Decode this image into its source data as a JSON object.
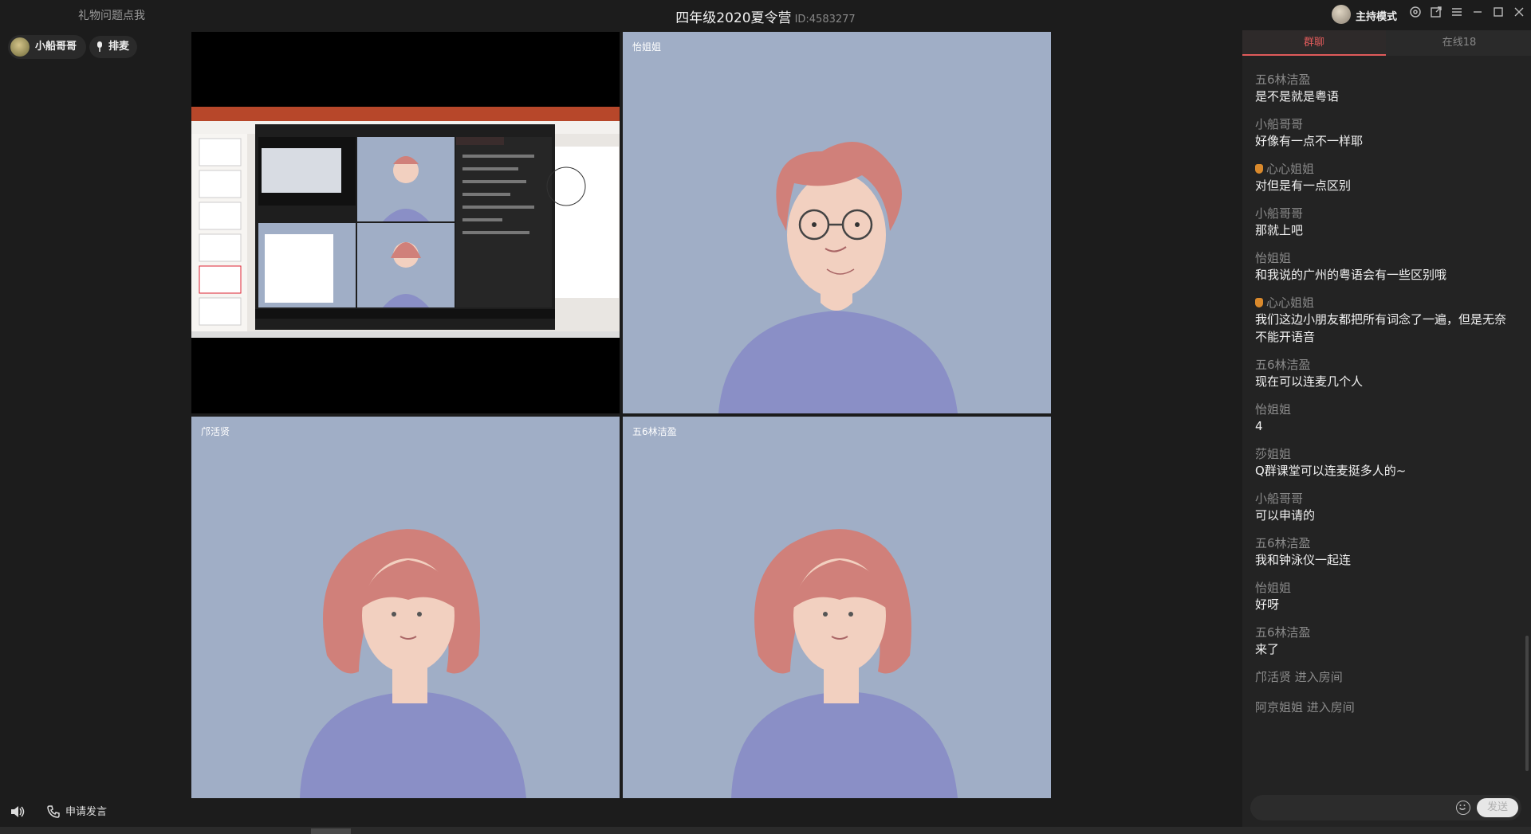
{
  "header": {
    "gift_link": "礼物问题点我",
    "room_title": "四年级2020夏令营",
    "room_id": "ID:4583277",
    "host_mode": "主持模式"
  },
  "left": {
    "user_name": "小船哥哥",
    "queue_label": "排麦"
  },
  "tiles": [
    {
      "label": ""
    },
    {
      "label": "怡姐姐"
    },
    {
      "label": "邝活贤"
    },
    {
      "label": "五6林洁盈"
    }
  ],
  "bottom": {
    "apply_label": "申请发言"
  },
  "chat": {
    "tab_group": "群聊",
    "tab_online": "在线18",
    "messages": [
      {
        "name": "五6林洁盈",
        "text": "是不是就是粤语"
      },
      {
        "name": "小船哥哥",
        "text": "好像有一点不一样耶"
      },
      {
        "name": "心心姐姐",
        "text": "对但是有一点区别"
      },
      {
        "name": "小船哥哥",
        "text": "那就上吧"
      },
      {
        "name": "怡姐姐",
        "text": "和我说的广州的粤语会有一些区别哦"
      },
      {
        "name": "心心姐姐",
        "text": "我们这边小朋友都把所有词念了一遍，但是无奈不能开语音"
      },
      {
        "name": "五6林洁盈",
        "text": "现在可以连麦几个人"
      },
      {
        "name": "怡姐姐",
        "text": "4"
      },
      {
        "name": "莎姐姐",
        "text": "Q群课堂可以连麦挺多人的~"
      },
      {
        "name": "小船哥哥",
        "text": "可以申请的"
      },
      {
        "name": "五6林洁盈",
        "text": "我和钟泳仪一起连"
      },
      {
        "name": "怡姐姐",
        "text": "好呀"
      },
      {
        "name": "五6林洁盈",
        "text": "来了"
      }
    ],
    "system": [
      "邝活贤 进入房间",
      "阿京姐姐 进入房间"
    ],
    "send_label": "发送"
  },
  "colors": {
    "accent": "#e05b5b",
    "tile_bg": "#a0aec6",
    "shirt": "#8a8fc6",
    "hair": "#d0807a"
  }
}
